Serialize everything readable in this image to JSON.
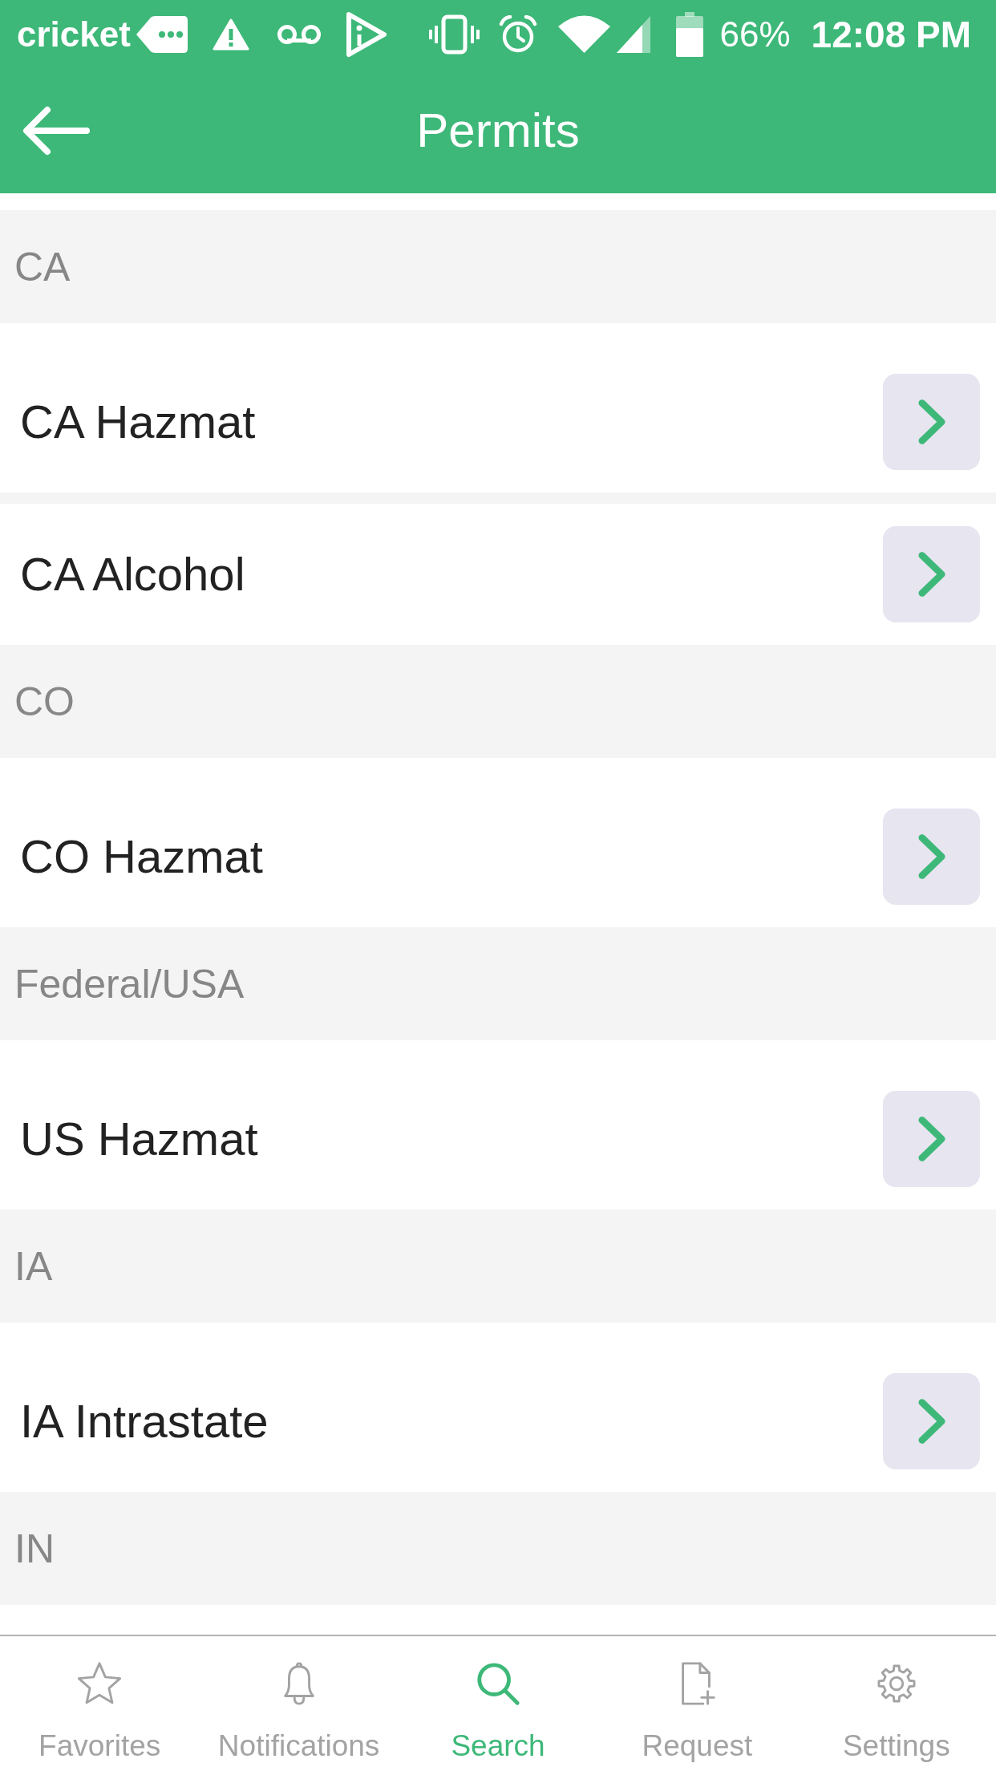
{
  "status_bar": {
    "carrier": "cricket",
    "battery": "66%",
    "time": "12:08 PM"
  },
  "app_bar": {
    "title": "Permits"
  },
  "sections": [
    {
      "name": "CA",
      "permits": [
        "CA Hazmat",
        "CA Alcohol"
      ]
    },
    {
      "name": "CO",
      "permits": [
        "CO Hazmat"
      ]
    },
    {
      "name": "Federal/USA",
      "permits": [
        "US Hazmat"
      ]
    },
    {
      "name": "IA",
      "permits": [
        "IA Intrastate"
      ]
    },
    {
      "name": "IN"
    }
  ],
  "bottom_nav": [
    {
      "label": "Favorites",
      "selected": false
    },
    {
      "label": "Notifications",
      "selected": false
    },
    {
      "label": "Search",
      "selected": true
    },
    {
      "label": "Request",
      "selected": false
    },
    {
      "label": "Settings",
      "selected": false
    }
  ]
}
